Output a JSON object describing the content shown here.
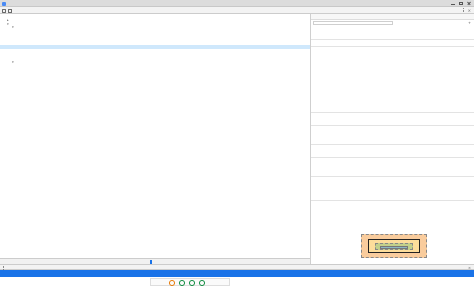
{
  "window": {
    "title": ""
  },
  "devtools": {
    "tabs": [
      {
        "label": "",
        "active": true
      },
      {
        "label": ""
      },
      {
        "label": ""
      },
      {
        "label": ""
      },
      {
        "label": ""
      },
      {
        "label": ""
      },
      {
        "label": ""
      },
      {
        "label": ""
      },
      {
        "label": ""
      },
      {
        "label": ""
      }
    ]
  },
  "elements": {
    "lines": [
      {
        "indent": 0,
        "tri": "",
        "text": ""
      },
      {
        "indent": 1,
        "tri": "▶",
        "text": ""
      },
      {
        "indent": 1,
        "tri": "▼",
        "text": ""
      },
      {
        "indent": 2,
        "tri": "▼",
        "text": ""
      },
      {
        "indent": 3,
        "tri": "",
        "text": ""
      },
      {
        "indent": 3,
        "tri": "",
        "text": ""
      },
      {
        "indent": 3,
        "tri": "",
        "text": ""
      },
      {
        "indent": 3,
        "tri": "",
        "text": ""
      },
      {
        "indent": 3,
        "tri": "",
        "text": ""
      },
      {
        "indent": 3,
        "tri": "",
        "text": ""
      },
      {
        "indent": 3,
        "tri": "",
        "text": ""
      },
      {
        "indent": 2,
        "tri": "",
        "text": ""
      },
      {
        "indent": 2,
        "tri": "▼",
        "text": ""
      },
      {
        "indent": 3,
        "tri": "",
        "text": ""
      },
      {
        "indent": 3,
        "tri": "",
        "text": ""
      },
      {
        "indent": 3,
        "tri": "",
        "text": ""
      },
      {
        "indent": 3,
        "tri": "",
        "text": ""
      },
      {
        "indent": 3,
        "tri": "",
        "text": ""
      },
      {
        "indent": 3,
        "tri": "",
        "text": ""
      },
      {
        "indent": 3,
        "tri": "",
        "text": ""
      },
      {
        "indent": 3,
        "tri": "",
        "text": ""
      },
      {
        "indent": 3,
        "tri": "",
        "text": ""
      },
      {
        "indent": 2,
        "tri": "",
        "text": ""
      },
      {
        "indent": 1,
        "tri": "",
        "text": ""
      },
      {
        "indent": 0,
        "tri": "",
        "text": ""
      }
    ],
    "selected_index": 8
  },
  "breadcrumbs": [
    {
      "label": ""
    },
    {
      "label": ""
    },
    {
      "label": ""
    },
    {
      "label": ""
    },
    {
      "label": ""
    },
    {
      "label": "",
      "active": true
    }
  ],
  "styles_panel": {
    "tabs": [
      {
        "label": "",
        "active": true
      },
      {
        "label": ""
      },
      {
        "label": ""
      },
      {
        "label": ""
      },
      {
        "label": ""
      }
    ],
    "filter_placeholder": "",
    "hov_label": "",
    "cls_label": "",
    "add_label": "+",
    "rules": [
      {
        "text": "",
        "kind": "sel"
      },
      {
        "text": "",
        "kind": "prop"
      },
      {
        "text": "",
        "kind": "sel"
      },
      {
        "text": "",
        "kind": "sel"
      },
      {
        "text": "",
        "kind": "prop"
      },
      {
        "text": "",
        "kind": "prop"
      },
      {
        "text": "",
        "kind": "prop"
      },
      {
        "text": "",
        "kind": "prop"
      },
      {
        "text": "",
        "kind": "prop"
      },
      {
        "text": "",
        "kind": "prop"
      },
      {
        "text": "",
        "kind": "prop"
      },
      {
        "text": "",
        "kind": "prop"
      },
      {
        "text": "",
        "kind": "prop"
      },
      {
        "text": "",
        "kind": "prop"
      },
      {
        "text": "",
        "kind": "sel"
      },
      {
        "text": "",
        "kind": "prop"
      },
      {
        "text": "",
        "kind": "sel"
      },
      {
        "text": "",
        "kind": "prop"
      },
      {
        "text": "",
        "kind": "prop"
      },
      {
        "text": "",
        "kind": "sel"
      },
      {
        "text": "",
        "kind": "prop"
      },
      {
        "text": "",
        "kind": "sel"
      },
      {
        "text": "",
        "kind": "prop"
      },
      {
        "text": "",
        "kind": "prop"
      },
      {
        "text": "",
        "kind": "sel"
      },
      {
        "text": "",
        "kind": "prop"
      },
      {
        "text": "",
        "kind": "prop"
      },
      {
        "text": "",
        "kind": "prop"
      },
      {
        "text": "",
        "kind": "sel"
      },
      {
        "text": "",
        "kind": "prop"
      },
      {
        "text": "",
        "kind": "prop"
      },
      {
        "text": "",
        "kind": "prop"
      },
      {
        "text": "",
        "kind": "prop"
      }
    ],
    "box_model_labels": {
      "margin": "",
      "border": "",
      "padding": "",
      "content": ""
    }
  },
  "drawer": {
    "tabs": [
      {
        "label": "",
        "active": true
      },
      {
        "label": ""
      }
    ],
    "banner_text": "",
    "items": [
      {
        "heading": "",
        "desc": ""
      },
      {
        "heading": "",
        "desc": ""
      }
    ]
  },
  "colors": {
    "accent": "#1a73e8",
    "selection": "#cfe8fc",
    "tag": "#881280",
    "attr": "#994500",
    "value": "#1a1aa6",
    "prop": "#c80000"
  },
  "icons": {
    "inspect": "inspect-icon",
    "device": "device-toggle-icon",
    "more": "more-vertical-icon",
    "close": "close-icon",
    "drawer_menu": "drawer-menu-icon",
    "app": "devtools-app-icon"
  }
}
